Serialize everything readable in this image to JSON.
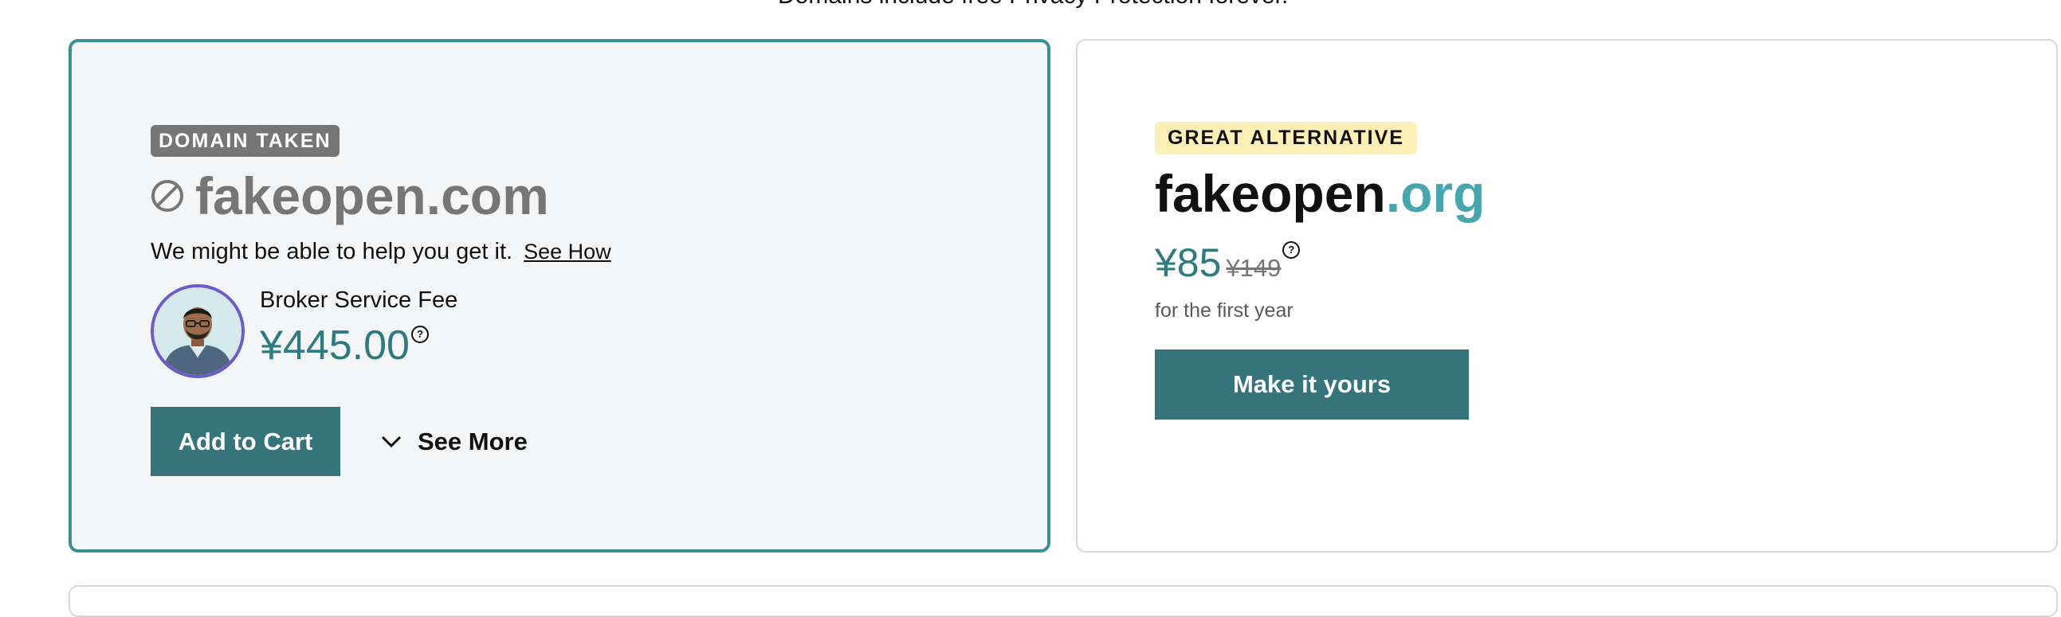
{
  "header": {
    "notice": "Domains include free Privacy Protection forever."
  },
  "taken_card": {
    "badge": "DOMAIN TAKEN",
    "domain": "fakeopen.com",
    "help_text": "We might be able to help you get it.",
    "help_link": "See How",
    "broker_label": "Broker Service Fee",
    "broker_price": "¥445.00",
    "help_icon_glyph": "?",
    "add_to_cart": "Add to Cart",
    "see_more": "See More"
  },
  "alternative_card": {
    "badge": "GREAT ALTERNATIVE",
    "domain_name": "fakeopen",
    "domain_tld": ".org",
    "price": "¥85",
    "old_price": "¥149",
    "help_icon_glyph": "?",
    "price_note": "for the first year",
    "cta": "Make it yours"
  },
  "icons": {
    "blocked": "blocked-circle-icon",
    "chevron": "chevron-down-icon",
    "help": "question-circle-icon"
  },
  "colors": {
    "accent_teal": "#35747a",
    "price_teal": "#2f7a80",
    "tld_teal": "#46a5ad",
    "selected_border": "#3d8f96",
    "avatar_border": "#6e5bc7",
    "taken_badge_bg": "#767676",
    "alt_badge_bg": "#fdf0b6"
  }
}
